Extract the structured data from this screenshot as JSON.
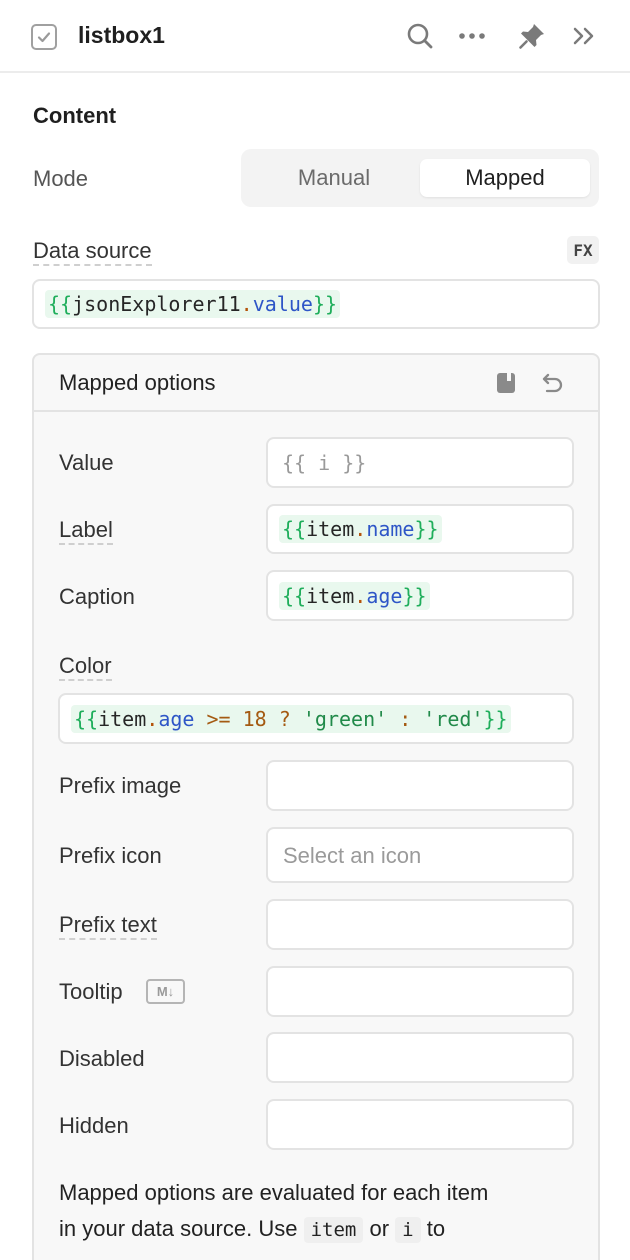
{
  "header": {
    "title": "listbox1",
    "icons": [
      "checkbox-icon",
      "search-icon",
      "more-icon",
      "pin-icon",
      "collapse-icon"
    ]
  },
  "content": {
    "section_title": "Content",
    "mode": {
      "label": "Mode",
      "options": [
        "Manual",
        "Mapped"
      ],
      "selected": "Mapped"
    },
    "data_source": {
      "label": "Data source",
      "fx_label": "FX",
      "value": "{{jsonExplorer11.value}}"
    }
  },
  "mapped": {
    "title": "Mapped options",
    "fields": {
      "value": {
        "label": "Value",
        "placeholder": "{{ i }}"
      },
      "label": {
        "label": "Label",
        "value": "{{item.name}}"
      },
      "caption": {
        "label": "Caption",
        "value": "{{item.age}}"
      },
      "color": {
        "label": "Color",
        "value": "{{item.age >= 18 ? 'green' : 'red'}}"
      },
      "prefix_image": {
        "label": "Prefix image",
        "value": ""
      },
      "prefix_icon": {
        "label": "Prefix icon",
        "placeholder": "Select an icon"
      },
      "prefix_text": {
        "label": "Prefix text",
        "value": ""
      },
      "tooltip": {
        "label": "Tooltip",
        "badge": "M↓",
        "value": ""
      },
      "disabled": {
        "label": "Disabled",
        "value": ""
      },
      "hidden": {
        "label": "Hidden",
        "value": ""
      }
    },
    "note": {
      "line1": "Mapped options are evaluated for each item",
      "line2_before": "in your data source. Use",
      "chip_item": "item",
      "or": "or",
      "chip_i": "i",
      "line2_after": "to"
    }
  },
  "colors": {
    "accent_green": "#1fae5b",
    "prop_blue": "#2e56c7",
    "dot_orange": "#b45309",
    "code_highlight": "#e9f8ee"
  }
}
